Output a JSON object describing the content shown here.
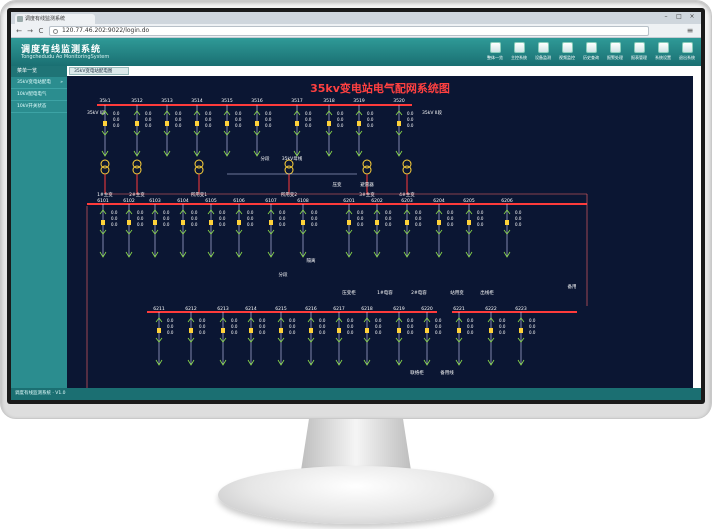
{
  "browser": {
    "tab_title": "调度有线监测系统",
    "url": "120.77.46.202:9022/login.do",
    "window_buttons": [
      "–",
      "□",
      "×"
    ],
    "nav": {
      "back": "←",
      "forward": "→",
      "reload": "C"
    },
    "menu_icon": "≡"
  },
  "app": {
    "title": "调度有线监测系统",
    "subtitle": "Tongchedudu Ao MonitoringSystem",
    "toolbar": [
      {
        "label": "整体一览",
        "icon": "overview-icon"
      },
      {
        "label": "主控系统",
        "icon": "control-icon"
      },
      {
        "label": "设备监测",
        "icon": "monitor-icon"
      },
      {
        "label": "视频监控",
        "icon": "video-icon"
      },
      {
        "label": "历史查询",
        "icon": "history-icon"
      },
      {
        "label": "报警处理",
        "icon": "alarm-icon"
      },
      {
        "label": "报表管理",
        "icon": "report-icon"
      },
      {
        "label": "系统设置",
        "icon": "settings-icon"
      },
      {
        "label": "退出系统",
        "icon": "exit-icon"
      }
    ]
  },
  "sidebar": {
    "header": "菜单一览",
    "items": [
      {
        "label": "35kV变电站配电",
        "arrow": "»"
      },
      {
        "label": "10kV配电电气",
        "arrow": ""
      },
      {
        "label": "10kV开关状态",
        "arrow": ""
      }
    ]
  },
  "content": {
    "tab": "35kV变电站配电图"
  },
  "diagram": {
    "title": "35kv变电站电气配网系统图",
    "top_feeders": [
      "35k1",
      "3512",
      "3513",
      "3514",
      "3515",
      "3516",
      "3517",
      "3518",
      "3519",
      "3520"
    ],
    "top_left_label": "35kV I段",
    "top_right_label": "35kV II段",
    "transformer_labels": [
      "1#主变",
      "2#主变",
      "所用变1",
      "所用变2",
      "3#主变",
      "4#主变"
    ],
    "mid_labels": [
      "分段",
      "35kV母线",
      "压变",
      "避雷器"
    ],
    "row2_feeders": [
      "6101",
      "6102",
      "6103",
      "6104",
      "6105",
      "6106",
      "6107",
      "6108",
      "6201",
      "6202",
      "6203",
      "6204",
      "6205",
      "6206"
    ],
    "row2_bottom_labels": [
      "分段",
      "隔离",
      "压变柜",
      "1#电容",
      "2#电容",
      "站用变",
      "出线柜",
      "备用"
    ],
    "row3_feeders": [
      "6211",
      "6212",
      "6213",
      "6214",
      "6215",
      "6216",
      "6217",
      "6218",
      "6219",
      "6220",
      "6221",
      "6222",
      "6223"
    ],
    "row3_bottom_labels": [
      "联络柜",
      "备用线"
    ],
    "bay_values": [
      "0.0",
      "0.0",
      "0.0"
    ]
  },
  "statusbar": {
    "text": "调度有线监测系统 · V1.0"
  },
  "colors": {
    "diagram_bg": "#0b1633",
    "bus_red": "#ff3b3b",
    "switch_green": "#8fe04b",
    "switch_yellow": "#ffd23a",
    "header_teal": "#1a6f72"
  }
}
